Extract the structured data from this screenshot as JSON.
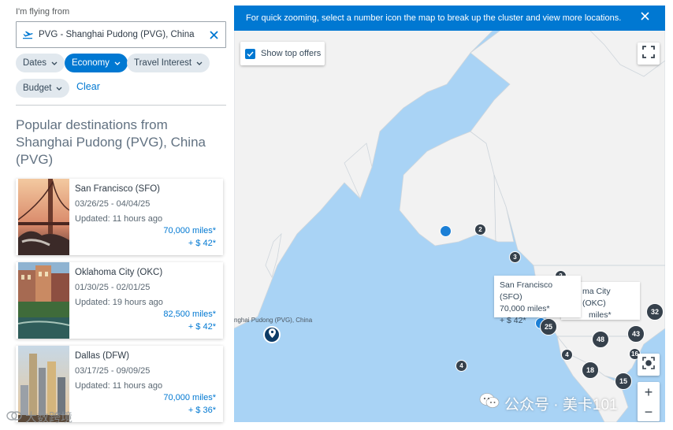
{
  "search": {
    "flying_label": "I'm flying from",
    "origin_value": "PVG - Shanghai Pudong (PVG), China"
  },
  "filters": {
    "dates": "Dates",
    "economy": "Economy",
    "travel_interest": "Travel Interest",
    "budget": "Budget",
    "clear": "Clear"
  },
  "results": {
    "title": "Popular destinations from Shanghai Pudong (PVG), China (PVG)",
    "cards": [
      {
        "city": "San Francisco (SFO)",
        "dates": "03/26/25 - 04/04/25",
        "updated": "Updated: 11 hours ago",
        "miles": "70,000 miles*",
        "tax": "+ $ 42*"
      },
      {
        "city": "Oklahoma City (OKC)",
        "dates": "01/30/25 - 02/01/25",
        "updated": "Updated: 19 hours ago",
        "miles": "82,500 miles*",
        "tax": "+ $ 42*"
      },
      {
        "city": "Dallas (DFW)",
        "dates": "03/17/25 - 09/09/25",
        "updated": "Updated: 11 hours ago",
        "miles": "70,000 miles*",
        "tax": "+ $ 36*"
      }
    ]
  },
  "map": {
    "banner": "For quick zooming, select a number icon the map to break up the cluster and view more locations.",
    "show_top_offers": "Show top offers",
    "origin_label": "nghai Pudong (PVG), China",
    "clusters": [
      "2",
      "3",
      "2",
      "25",
      "43",
      "32",
      "48",
      "16",
      "4",
      "18",
      "15",
      "4"
    ],
    "popup_sfo": {
      "city": "San Francisco (SFO)",
      "miles": "70,000 miles*",
      "tax": "+ $ 42*"
    },
    "popup_okc": {
      "city": "ma City (OKC)",
      "miles": "miles*"
    },
    "zoom_in": "+",
    "zoom_out": "−"
  },
  "watermarks": {
    "left": "大数跨境",
    "right": "公众号 · 美卡101"
  },
  "colors": {
    "accent": "#0078d2",
    "ocean": "#a9d3f5",
    "land": "#f2f2f2",
    "cluster": "#36414c"
  }
}
